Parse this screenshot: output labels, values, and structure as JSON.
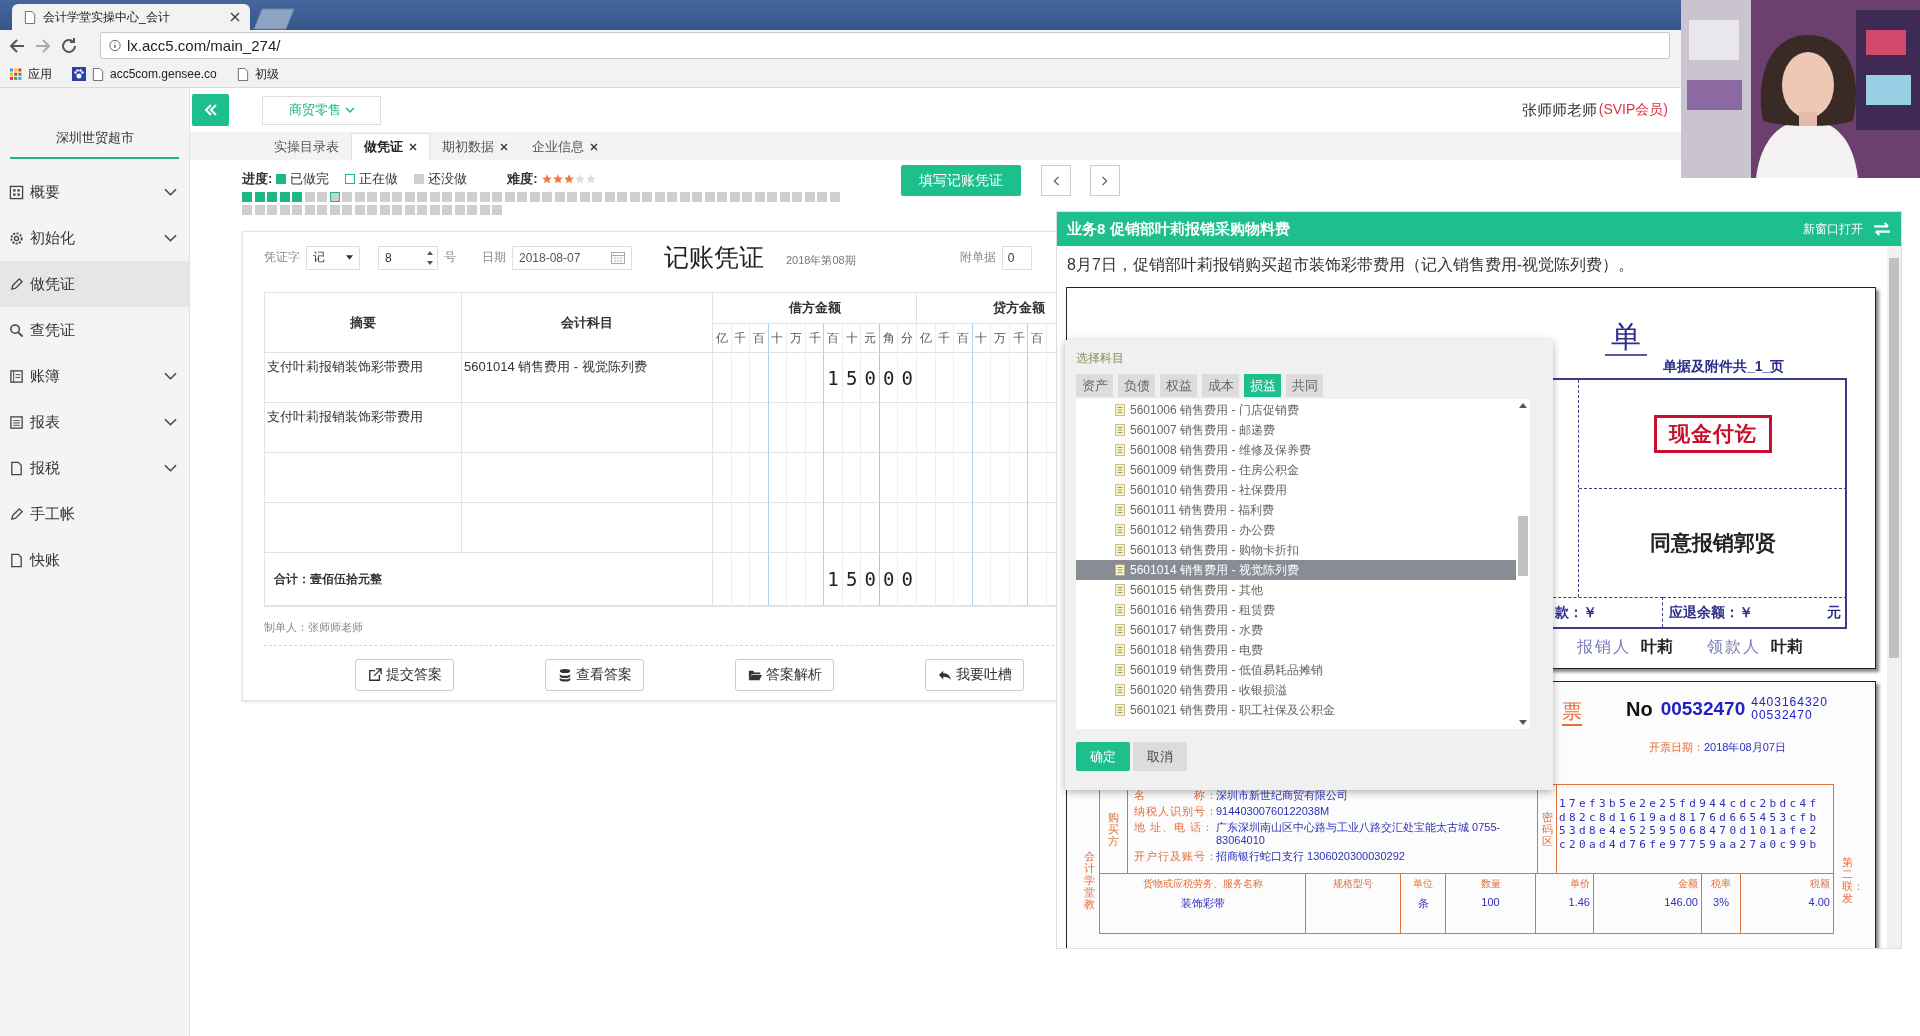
{
  "browser": {
    "tab_title": "会计学堂实操中心_会计",
    "address": "lx.acc5.com/main_274/",
    "bookmarks": [
      "应用",
      "acc5com.gensee.co",
      "初级"
    ]
  },
  "sidebar": {
    "company": "深圳世贸超市",
    "items": [
      {
        "label": "概要",
        "selected": false,
        "expandable": true
      },
      {
        "label": "初始化",
        "selected": false,
        "expandable": true
      },
      {
        "label": "做凭证",
        "selected": true,
        "expandable": false
      },
      {
        "label": "查凭证",
        "selected": false,
        "expandable": false
      },
      {
        "label": "账簿",
        "selected": false,
        "expandable": true
      },
      {
        "label": "报表",
        "selected": false,
        "expandable": true
      },
      {
        "label": "报税",
        "selected": false,
        "expandable": true
      },
      {
        "label": "手工帐",
        "selected": false,
        "expandable": false
      },
      {
        "label": "快账",
        "selected": false,
        "expandable": false
      }
    ]
  },
  "topbar": {
    "industry": "商贸零售",
    "user": "张师师老师",
    "badge": "(SVIP会员)"
  },
  "tabs": [
    {
      "label": "实操目录表",
      "selected": false,
      "closable": false
    },
    {
      "label": "做凭证",
      "selected": true,
      "closable": true
    },
    {
      "label": "期初数据",
      "selected": false,
      "closable": true
    },
    {
      "label": "企业信息",
      "selected": false,
      "closable": true
    }
  ],
  "progress": {
    "label": "进度:",
    "legend": [
      {
        "kind": "done",
        "label": "已做完"
      },
      {
        "kind": "doing",
        "label": "正在做"
      },
      {
        "kind": "todo",
        "label": "还没做"
      }
    ],
    "difficulty_label": "难度:",
    "stars": 3,
    "tasks": [
      {
        "done": true,
        "current": false
      },
      {
        "done": true,
        "current": false
      },
      {
        "done": true,
        "current": false
      },
      {
        "done": true,
        "current": false
      },
      {
        "done": true,
        "current": false
      },
      {
        "done": false,
        "current": false
      },
      {
        "done": false,
        "current": false
      },
      {
        "done": false,
        "current": true
      },
      {
        "done": false,
        "current": false
      },
      {
        "done": false,
        "current": false
      },
      {
        "done": false,
        "current": false
      },
      {
        "done": false,
        "current": false
      },
      {
        "done": false,
        "current": false
      },
      {
        "done": false,
        "current": false
      },
      {
        "done": false,
        "current": false
      },
      {
        "done": false,
        "current": false
      },
      {
        "done": false,
        "current": false
      },
      {
        "done": false,
        "current": false
      },
      {
        "done": false,
        "current": false
      },
      {
        "done": false,
        "current": false
      },
      {
        "done": false,
        "current": false
      },
      {
        "done": false,
        "current": false
      },
      {
        "done": false,
        "current": false
      },
      {
        "done": false,
        "current": false
      },
      {
        "done": false,
        "current": false
      },
      {
        "done": false,
        "current": false
      },
      {
        "done": false,
        "current": false
      },
      {
        "done": false,
        "current": false
      },
      {
        "done": false,
        "current": false
      },
      {
        "done": false,
        "current": false
      },
      {
        "done": false,
        "current": false
      },
      {
        "done": false,
        "current": false
      },
      {
        "done": false,
        "current": false
      },
      {
        "done": false,
        "current": false
      },
      {
        "done": false,
        "current": false
      },
      {
        "done": false,
        "current": false
      },
      {
        "done": false,
        "current": false
      },
      {
        "done": false,
        "current": false
      },
      {
        "done": false,
        "current": false
      },
      {
        "done": false,
        "current": false
      },
      {
        "done": false,
        "current": false
      },
      {
        "done": false,
        "current": false
      },
      {
        "done": false,
        "current": false
      },
      {
        "done": false,
        "current": false
      },
      {
        "done": false,
        "current": false
      },
      {
        "done": false,
        "current": false
      },
      {
        "done": false,
        "current": false
      },
      {
        "done": false,
        "current": false
      },
      {
        "done": false,
        "current": false
      },
      {
        "done": false,
        "current": false
      },
      {
        "done": false,
        "current": false
      },
      {
        "done": false,
        "current": false
      },
      {
        "done": false,
        "current": false
      },
      {
        "done": false,
        "current": false
      },
      {
        "done": false,
        "current": false
      },
      {
        "done": false,
        "current": false
      },
      {
        "done": false,
        "current": false
      },
      {
        "done": false,
        "current": false
      },
      {
        "done": false,
        "current": false
      },
      {
        "done": false,
        "current": false
      },
      {
        "done": false,
        "current": false
      },
      {
        "done": false,
        "current": false
      },
      {
        "done": false,
        "current": false
      },
      {
        "done": false,
        "current": false
      },
      {
        "done": false,
        "current": false
      },
      {
        "done": false,
        "current": false
      },
      {
        "done": false,
        "current": false
      },
      {
        "done": false,
        "current": false
      },
      {
        "done": false,
        "current": false
      }
    ]
  },
  "fill_button": "填写记账凭证",
  "voucher": {
    "word_label": "凭证字",
    "word": "记",
    "number": "8",
    "number_suffix": "号",
    "date_label": "日期",
    "date": "2018-08-07",
    "title": "记账凭证",
    "period": "2018年第08期",
    "attachments_label": "附单据",
    "attachments": "0",
    "columns": {
      "summary": "摘要",
      "account": "会计科目",
      "debit": "借方金额",
      "credit": "贷方金额",
      "debit_units": [
        "亿",
        "千",
        "百",
        "十",
        "万",
        "千",
        "百",
        "十",
        "元",
        "角",
        "分"
      ],
      "credit_units": [
        "亿",
        "千",
        "百",
        "十",
        "万",
        "千",
        "百"
      ]
    },
    "rows": [
      {
        "summary": "支付叶莉报销装饰彩带费用",
        "account": "5601014 销售费用 - 视觉陈列费",
        "debit": [
          "1",
          "5",
          "0",
          "0",
          "0"
        ]
      },
      {
        "summary": "支付叶莉报销装饰彩带费用"
      },
      {},
      {}
    ],
    "total": {
      "label": "合计：壹佰伍拾元整",
      "debit": [
        "1",
        "5",
        "0",
        "0",
        "0"
      ]
    },
    "maker": "制单人：张师师老师"
  },
  "actions": [
    "提交答案",
    "查看答案",
    "答案解析",
    "我要吐槽"
  ],
  "task_panel": {
    "title": "业务8 促销部叶莉报销采购物料费",
    "open_new": "新窗口打开",
    "description": "8月7日，促销部叶莉报销购买超市装饰彩带费用（记入销售费用-视觉陈列费）。",
    "expense_form": {
      "title": "单",
      "attachments": "单据及附件共_1_页",
      "stamp": "现金付讫",
      "approval": "同意报销郭贤",
      "paid_label": "款：￥",
      "refund_label": "应退余额：￥",
      "unit": "元",
      "claimant_label": "报销人",
      "claimant": "叶莉",
      "payee_label": "领款人",
      "payee": "叶莉"
    },
    "invoice": {
      "title_fragment": "票",
      "number_label": "No",
      "number": "00532470",
      "code": "4403164320",
      "code_number": "00532470",
      "date_label": "开票日期：",
      "date": "2018年08月07日",
      "side_note": "会计学堂教",
      "copy_note": "第二联：发",
      "buyer_label": "购买方",
      "buyer": [
        {
          "label": "名　　　　称：",
          "value": "深圳市新世纪商贸有限公司"
        },
        {
          "label": "纳税人识别号：",
          "value": "91440300760122038M"
        },
        {
          "label": "地 址、电 话：",
          "value": "广东深圳南山区中心路与工业八路交汇处宝能太古城 0755-83064010"
        },
        {
          "label": "开户行及账号：",
          "value": "招商银行蛇口支行 1306020300030292"
        }
      ],
      "cipher_label": "密码区",
      "cipher": [
        "17ef3b5e2e25fd944cdc2bdc4f",
        "d82c8d1619ad8176d665453cfb",
        "53d8e4e52595068470d101afe2",
        "c20ad4d76fe97759aa27a0c99b"
      ],
      "goods_columns": [
        "货物或应税劳务、服务名称",
        "规格型号",
        "单位",
        "数量",
        "单价",
        "金额",
        "税率",
        "税额"
      ],
      "goods": {
        "name": "装饰彩带",
        "unit": "条",
        "quantity": "100",
        "price": "1.46",
        "amount": "146.00",
        "rate": "3%",
        "tax": "4.00"
      }
    }
  },
  "account_dialog": {
    "title": "选择科目",
    "tabs": [
      {
        "label": "资产",
        "selected": false
      },
      {
        "label": "负债",
        "selected": false
      },
      {
        "label": "权益",
        "selected": false
      },
      {
        "label": "成本",
        "selected": false
      },
      {
        "label": "损益",
        "selected": true
      },
      {
        "label": "共同",
        "selected": false
      }
    ],
    "items": [
      {
        "label": "5601006 销售费用 - 门店促销费",
        "selected": false
      },
      {
        "label": "5601007 销售费用 - 邮递费",
        "selected": false
      },
      {
        "label": "5601008 销售费用 - 维修及保养费",
        "selected": false
      },
      {
        "label": "5601009 销售费用 - 住房公积金",
        "selected": false
      },
      {
        "label": "5601010 销售费用 - 社保费用",
        "selected": false
      },
      {
        "label": "5601011 销售费用 - 福利费",
        "selected": false
      },
      {
        "label": "5601012 销售费用 - 办公费",
        "selected": false
      },
      {
        "label": "5601013 销售费用 - 购物卡折扣",
        "selected": false
      },
      {
        "label": "5601014 销售费用 - 视觉陈列费",
        "selected": true
      },
      {
        "label": "5601015 销售费用 - 其他",
        "selected": false
      },
      {
        "label": "5601016 销售费用 - 租赁费",
        "selected": false
      },
      {
        "label": "5601017 销售费用 - 水费",
        "selected": false
      },
      {
        "label": "5601018 销售费用 - 电费",
        "selected": false
      },
      {
        "label": "5601019 销售费用 - 低值易耗品摊销",
        "selected": false
      },
      {
        "label": "5601020 销售费用 - 收银损溢",
        "selected": false
      },
      {
        "label": "5601021 销售费用 - 职工社保及公积金",
        "selected": false
      }
    ],
    "buttons": [
      "确定",
      "取消"
    ]
  },
  "webcam": {
    "kind": "picture"
  }
}
